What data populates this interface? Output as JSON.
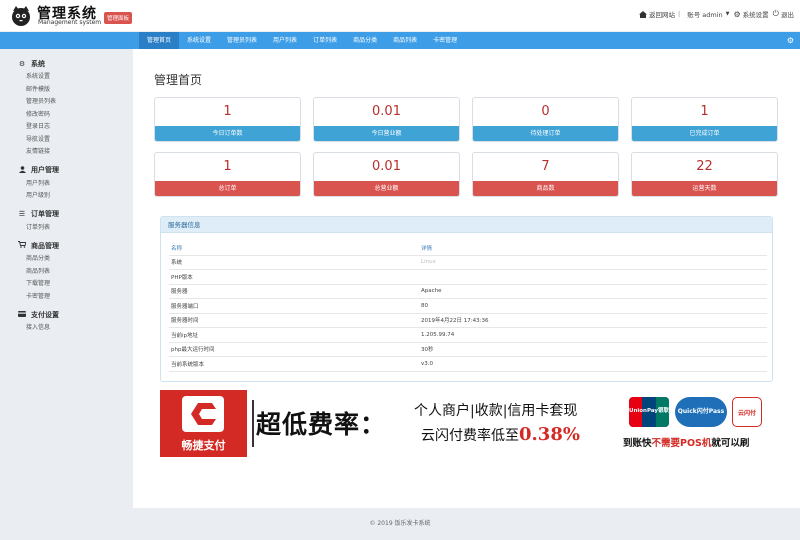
{
  "header": {
    "brand_cn": "管理系统",
    "brand_en": "Management system",
    "brand_badge": "管理面板",
    "home_link": "返回网站",
    "account": "账号 admin",
    "settings": "系统设置",
    "logout": "退出"
  },
  "nav": {
    "tabs": [
      {
        "label": "管理首页"
      },
      {
        "label": "系统设置"
      },
      {
        "label": "管理员列表"
      },
      {
        "label": "用户列表"
      },
      {
        "label": "订单列表"
      },
      {
        "label": "商品分类"
      },
      {
        "label": "商品列表"
      },
      {
        "label": "卡密管理"
      }
    ],
    "active": 0
  },
  "sidebar": {
    "sections": [
      {
        "title": "系统",
        "icon": "gear-icon",
        "items": [
          "系统设置",
          "邮件模版",
          "管理员列表",
          "修改密码",
          "登录日志",
          "导航设置",
          "友情链接"
        ]
      },
      {
        "title": "用户管理",
        "icon": "user-icon",
        "items": [
          "用户列表",
          "用户级别"
        ]
      },
      {
        "title": "订单管理",
        "icon": "list-icon",
        "items": [
          "订单列表"
        ]
      },
      {
        "title": "商品管理",
        "icon": "cart-icon",
        "items": [
          "商品分类",
          "商品列表",
          "下载管理",
          "卡密管理"
        ]
      },
      {
        "title": "支付设置",
        "icon": "card-icon",
        "items": [
          "接入信息"
        ]
      }
    ]
  },
  "main": {
    "title": "管理首页",
    "stats": [
      {
        "value": "1",
        "label": "今日订单数"
      },
      {
        "value": "0.01",
        "label": "今日营业额"
      },
      {
        "value": "0",
        "label": "待处理订单"
      },
      {
        "value": "1",
        "label": "已完成订单"
      },
      {
        "value": "1",
        "label": "总订单"
      },
      {
        "value": "0.01",
        "label": "总营业额"
      },
      {
        "value": "7",
        "label": "商品数"
      },
      {
        "value": "22",
        "label": "运营天数"
      }
    ],
    "server": {
      "title": "服务器信息",
      "col_name": "名称",
      "col_detail": "详情",
      "rows": [
        {
          "name": "系统",
          "value": "Linux"
        },
        {
          "name": "PHP版本",
          "value": ""
        },
        {
          "name": "服务器",
          "value": "Apache"
        },
        {
          "name": "服务器端口",
          "value": "80"
        },
        {
          "name": "服务器时间",
          "value": "2019年4月22日 17:43:36"
        },
        {
          "name": "当前ip地址",
          "value": "1.205.99.74"
        },
        {
          "name": "php最大运行时间",
          "value": "30秒"
        },
        {
          "name": "当前系统版本",
          "value": "v3.0"
        }
      ]
    }
  },
  "banner": {
    "logo_text": "畅捷支付",
    "big_text": "超低费率：",
    "line1": "个人商户|收款|信用卡套现",
    "line2_prefix": "云闪付费率低至",
    "line2_rate": "0.38%",
    "unionpay": "UnionPay银联",
    "quickpass": "Quick闪付Pass",
    "yunshanfu": "云闪付",
    "small_prefix": "到账快",
    "small_red": "不需要POS机",
    "small_suffix": "就可以刷"
  },
  "footer": {
    "text": "© 2019 饭乐发卡系统"
  },
  "colors": {
    "nav_blue": "#3d9ee7",
    "card_blue": "#3fa3d6",
    "card_red": "#d9534f",
    "number_red": "#b5312c"
  }
}
